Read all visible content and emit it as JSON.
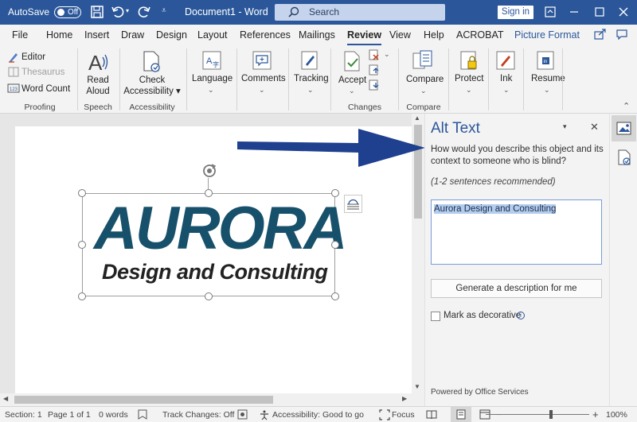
{
  "titlebar": {
    "autosave_label": "AutoSave",
    "autosave_state": "Off",
    "doc_title": "Document1  -  Word",
    "search_label": "Search",
    "signin_label": "Sign in"
  },
  "menu": {
    "tabs": [
      "File",
      "Home",
      "Insert",
      "Draw",
      "Design",
      "Layout",
      "References",
      "Mailings",
      "Review",
      "View",
      "Help",
      "ACROBAT",
      "Picture Format"
    ],
    "active": "Review"
  },
  "ribbon": {
    "proofing": {
      "editor": "Editor",
      "thesaurus": "Thesaurus",
      "word_count": "Word Count",
      "group": "Proofing"
    },
    "speech": {
      "read_aloud_1": "Read",
      "read_aloud_2": "Aloud",
      "group": "Speech"
    },
    "accessibility": {
      "check_1": "Check",
      "check_2": "Accessibility",
      "group": "Accessibility"
    },
    "language": "Language",
    "comments": "Comments",
    "tracking": "Tracking",
    "changes": {
      "accept": "Accept",
      "group": "Changes"
    },
    "compare": {
      "compare": "Compare",
      "group": "Compare"
    },
    "protect": "Protect",
    "ink": "Ink",
    "resume": "Resume"
  },
  "document": {
    "logo_main": "AURORA",
    "logo_sub": "Design and Consulting"
  },
  "alt_text_pane": {
    "title": "Alt Text",
    "prompt": "How would you describe this object and its context to someone who is blind?",
    "hint": "(1-2 sentences recommended)",
    "value": "Aurora Design and Consulting",
    "generate_button": "Generate a description for me",
    "decorative_label": "Mark as decorative",
    "powered_by": "Powered by Office Services"
  },
  "statusbar": {
    "section": "Section: 1",
    "page": "Page 1 of 1",
    "words": "0 words",
    "track_changes": "Track Changes: Off",
    "accessibility": "Accessibility: Good to go",
    "focus": "Focus",
    "zoom": "100%"
  },
  "colors": {
    "brand": "#2b579a",
    "logo_blue": "#17506a",
    "arrow": "#1f3f8f"
  }
}
